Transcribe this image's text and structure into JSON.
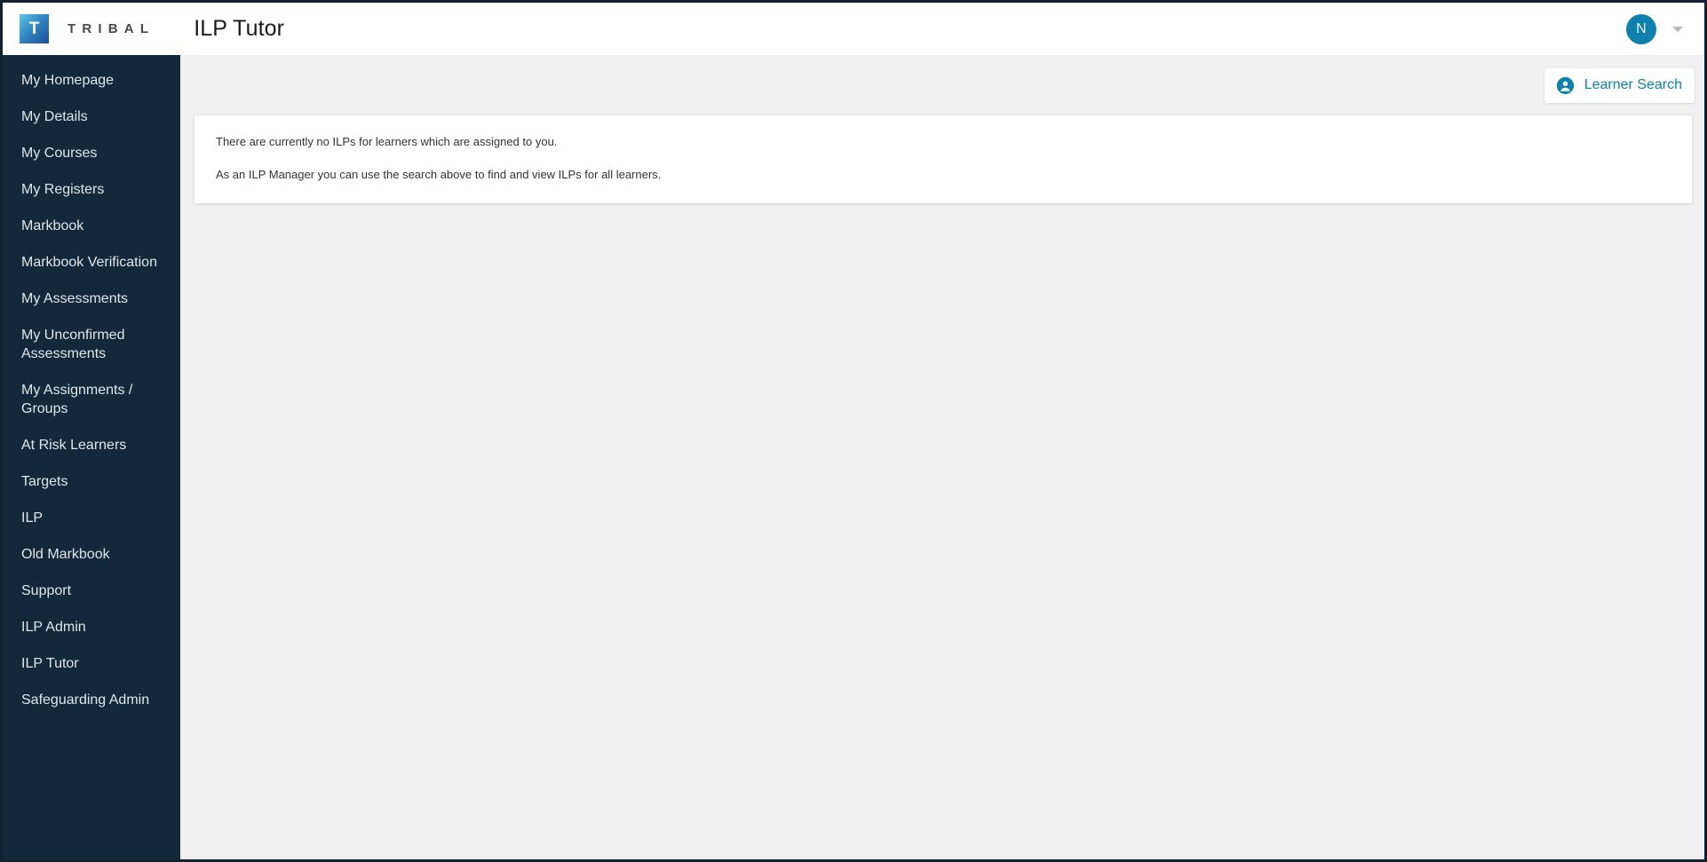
{
  "header": {
    "logo_letter": "T",
    "brand_name": "TRIBAL",
    "title": "ILP Tutor",
    "avatar_initial": "N",
    "logo_icon": "tribal-logo-icon",
    "caret_icon": "chevron-down-icon"
  },
  "sidebar": {
    "items": [
      {
        "label": "My Homepage"
      },
      {
        "label": "My Details"
      },
      {
        "label": "My Courses"
      },
      {
        "label": "My Registers"
      },
      {
        "label": "Markbook"
      },
      {
        "label": "Markbook Verification"
      },
      {
        "label": "My Assessments"
      },
      {
        "label": "My Unconfirmed Assessments"
      },
      {
        "label": "My Assignments / Groups"
      },
      {
        "label": "At Risk Learners"
      },
      {
        "label": "Targets"
      },
      {
        "label": "ILP"
      },
      {
        "label": "Old Markbook"
      },
      {
        "label": "Support"
      },
      {
        "label": "ILP Admin"
      },
      {
        "label": "ILP Tutor"
      },
      {
        "label": "Safeguarding Admin"
      }
    ]
  },
  "toolbar": {
    "learner_search_label": "Learner Search",
    "learner_search_icon": "person-icon"
  },
  "main": {
    "message_line_1": "There are currently no ILPs for learners which are assigned to you.",
    "message_line_2": "As an ILP Manager you can use the search above to find and view ILPs for all learners."
  },
  "colors": {
    "sidebar_bg": "#14283c",
    "accent_teal": "#0f7fab",
    "content_bg": "#f0f0f0",
    "card_bg": "#ffffff",
    "text_dark": "#333333"
  }
}
